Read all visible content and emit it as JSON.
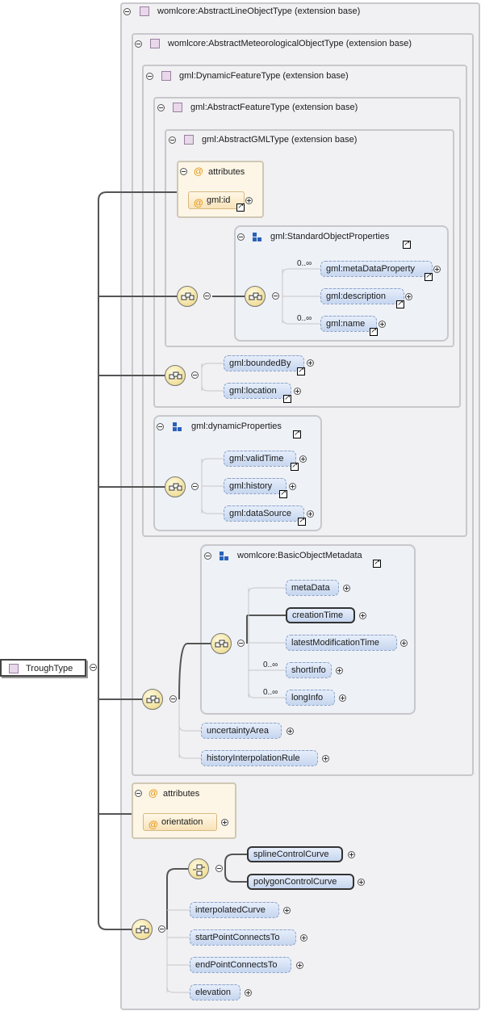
{
  "root": {
    "label": "TroughType"
  },
  "ext": {
    "line_object": "womlcore:AbstractLineObjectType (extension base)",
    "met_object": "womlcore:AbstractMeteorologicalObjectType (extension base)",
    "dynamic_feature": "gml:DynamicFeatureType (extension base)",
    "abstract_feature": "gml:AbstractFeatureType (extension base)",
    "abstract_gml": "gml:AbstractGMLType (extension base)"
  },
  "attributes_label": "attributes",
  "attr": {
    "id": "gml:id",
    "orientation": "orientation"
  },
  "groups": {
    "standard_object_properties": "gml:StandardObjectProperties",
    "dynamic_properties": "gml:dynamicProperties",
    "basic_object_metadata": "womlcore:BasicObjectMetadata"
  },
  "elements": {
    "meta_data_property": "gml:metaDataProperty",
    "description": "gml:description",
    "name": "gml:name",
    "bounded_by": "gml:boundedBy",
    "location": "gml:location",
    "valid_time": "gml:validTime",
    "history": "gml:history",
    "data_source": "gml:dataSource",
    "meta_data": "metaData",
    "creation_time": "creationTime",
    "latest_modification_time": "latestModificationTime",
    "short_info": "shortInfo",
    "long_info": "longInfo",
    "uncertainty_area": "uncertaintyArea",
    "history_interpolation_rule": "historyInterpolationRule",
    "spline_control_curve": "splineControlCurve",
    "polygon_control_curve": "polygonControlCurve",
    "interpolated_curve": "interpolatedCurve",
    "start_point_connects_to": "startPointConnectsTo",
    "end_point_connects_to": "endPointConnectsTo",
    "elevation": "elevation"
  },
  "occurrence": {
    "zero_many": "0..∞"
  },
  "icons": {
    "expanded": "minus-circle-icon",
    "collapsed": "plus-circle-icon",
    "sequence": "sequence-compositor-icon",
    "choice": "choice-compositor-icon",
    "reference": "reference-arrow-icon",
    "attribute": "at-sign-icon",
    "group": "group-icon",
    "type": "type-square-icon"
  },
  "colors": {
    "element_fill": "#c6d6ef",
    "attribute_fill": "#f8e2b8",
    "attribute_symbol": "#e49a1a",
    "group_icon": "#2a62b8",
    "compositor_fill": "#f0df9a",
    "type_square": "#e8d8ea",
    "frame_border": "#c8c8cc"
  }
}
